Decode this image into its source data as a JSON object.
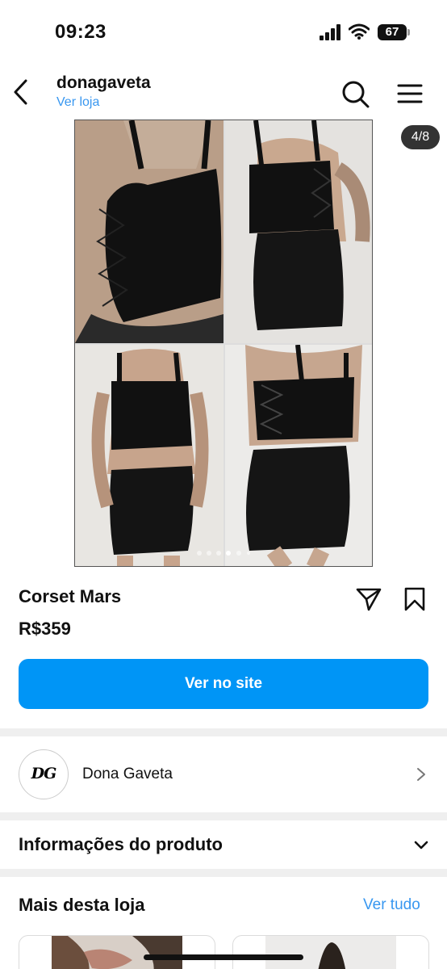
{
  "status_bar": {
    "time": "09:23",
    "battery": "67"
  },
  "header": {
    "shop_name": "donagaveta",
    "shop_link": "Ver loja"
  },
  "gallery": {
    "counter": "4/8",
    "current_index": 4,
    "total": 8
  },
  "product": {
    "title": "Corset Mars",
    "price": "R$359",
    "cta_label": "Ver no site"
  },
  "seller": {
    "logo_text": "DG",
    "name": "Dona Gaveta"
  },
  "info": {
    "title": "Informações do produto"
  },
  "more": {
    "title": "Mais desta loja",
    "see_all": "Ver tudo"
  },
  "colors": {
    "accent": "#0095f6",
    "link": "#3897f0",
    "separator": "#efefef"
  },
  "icons": [
    "chevron-left-icon",
    "search-icon",
    "menu-icon",
    "send-icon",
    "bookmark-icon",
    "chevron-right-icon",
    "chevron-down-icon",
    "signal-icon",
    "wifi-icon",
    "battery-icon"
  ]
}
